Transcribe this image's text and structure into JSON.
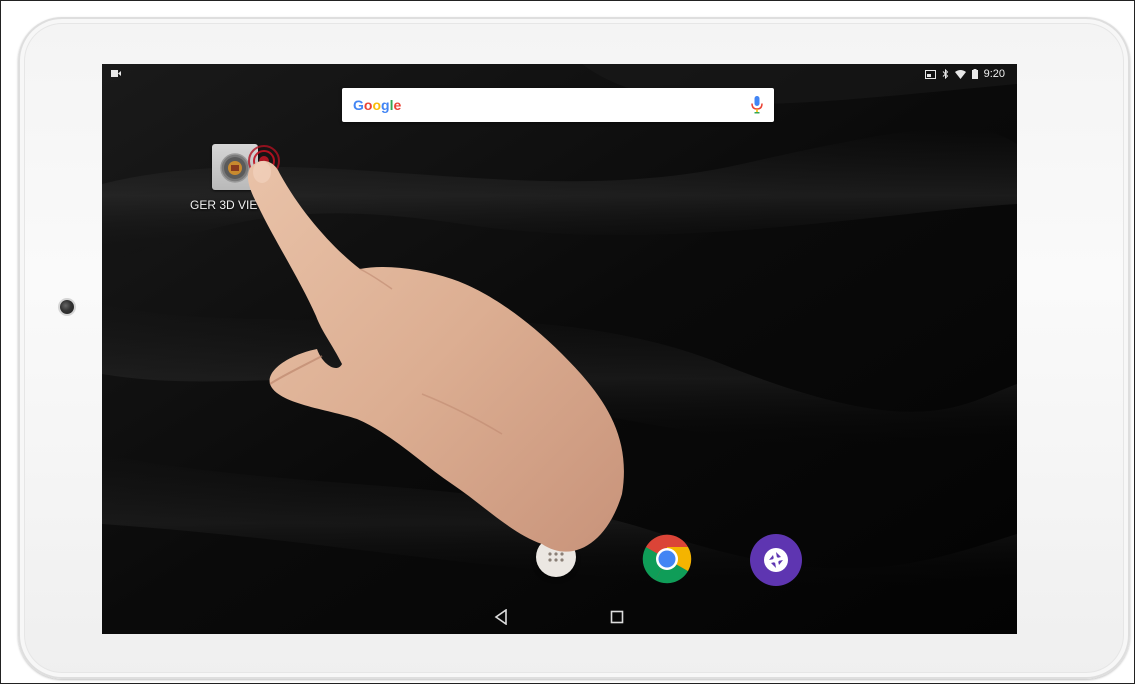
{
  "status_bar": {
    "time": "9:20",
    "left_icon": "video-record-icon",
    "right_icons": [
      "cast-icon",
      "bluetooth-icon",
      "wifi-icon",
      "battery-icon"
    ]
  },
  "search": {
    "logo_letters": [
      "G",
      "o",
      "o",
      "g",
      "l",
      "e"
    ],
    "mic_icon": "mic-icon"
  },
  "home_apps": [
    {
      "label": "GER 3D VIEW",
      "icon": "app-badge-icon"
    }
  ],
  "dock": [
    {
      "name": "app-drawer",
      "icon": "dots-grid-icon"
    },
    {
      "name": "chrome",
      "icon": "chrome-icon"
    },
    {
      "name": "camera",
      "icon": "camera-aperture-icon"
    }
  ],
  "nav": {
    "back_icon": "back-triangle-icon",
    "home_icon": "square-home-icon"
  },
  "colors": {
    "google_blue": "#4285f4",
    "google_red": "#ea4335",
    "google_yellow": "#fbbc05",
    "google_green": "#34a853",
    "camera_purple": "#5e35b1",
    "screen_bg": "#060606",
    "bezel": "#f4f4f4"
  }
}
